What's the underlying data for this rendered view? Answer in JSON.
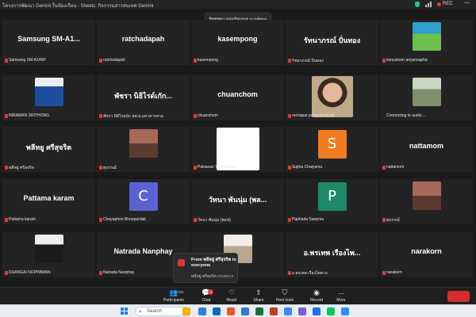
{
  "window": {
    "title": "โครงการพัฒนา Gemini ในห้องเรียน - Sheets: กิจกรรมสารสนเทศ Gemini",
    "status_rec": "REC",
    "colors": {
      "shield": "#2ec27e",
      "rec": "#e33333"
    }
  },
  "talking_banner": "รัชชทพา ผลจรัลมณย is talking...",
  "tiles": [
    {
      "big": "Samsung  SM-A1...",
      "label": "Samsung SM-A146P",
      "muted": true
    },
    {
      "big": "ratchadapah",
      "label": "ratchadapah",
      "muted": true
    },
    {
      "big": "kasempong",
      "label": "kasempong",
      "muted": true
    },
    {
      "big": "รัทนาภรณ์ ปั่นทอง",
      "label": "รัชนาภรณ์ ปั่นทอง",
      "muted": true
    },
    {
      "label": "kanyakorn anyarisapha",
      "muted": true,
      "photo": "cartoon"
    },
    {
      "label": "NIRAWAN SRITHONG",
      "muted": true,
      "photo": "woman-blue"
    },
    {
      "big": "พัชรา นิธิไรด์เกัก...",
      "label": "พัชรา นิธิไรดนัก สพ.ป.มหาสารคาม",
      "muted": true
    },
    {
      "big": "chuanchom",
      "label": "chuanchom",
      "muted": true
    },
    {
      "label": "rachapat pchayamahoot",
      "muted": true,
      "photo": "woman-glasses"
    },
    {
      "label": "Connecting to audio ...",
      "muted": false,
      "photo": "man-outdoor"
    },
    {
      "big": "พลีหยู ศรีสุจริต",
      "label": "พลีหยู่ ศรีสุจริต",
      "muted": true
    },
    {
      "label": "ศุภกรณ์",
      "muted": true,
      "photo": "person-indoor"
    },
    {
      "label": "Pakawan Thaveechai",
      "muted": true,
      "photo": "white"
    },
    {
      "avatar": "S",
      "avatar_color": "#f07d1f",
      "label": "Sujitra Chaiyama",
      "muted": true
    },
    {
      "big": "nattamom",
      "label": "nattamom",
      "muted": true
    },
    {
      "big": "Pattama karam",
      "label": "Pattama karam",
      "muted": true
    },
    {
      "avatar": "C",
      "avatar_color": "#5b63d3",
      "label": "Chayaphon Bhunpardab",
      "muted": true
    },
    {
      "big": "วัทนา พันนุ่ม (พล...",
      "label": "วัทนา พันนุ่ม (พลช)",
      "muted": true
    },
    {
      "avatar": "P",
      "avatar_color": "#1e8a69",
      "label": "Paphada Saepma",
      "muted": true
    },
    {
      "label": "ศุภกรณ์",
      "muted": true,
      "photo": "person-indoor"
    },
    {
      "label": "DUANGAI NOPPAWAN",
      "muted": true,
      "photo": "woman-dark"
    },
    {
      "big": "Natrada Nanphay",
      "label": "Natrada Nanphay",
      "muted": true
    },
    {
      "label": "",
      "muted": false,
      "photo": "man-partial"
    },
    {
      "big": "อ.พรเทพ เรืองไพ...",
      "label": "อ.พรเทพ เรืองไพศาล",
      "muted": true
    },
    {
      "big": "narakorn",
      "label": "narakorn",
      "muted": true
    }
  ],
  "chat_popup": {
    "from": "From พลีหยู่ ศรีสุจริต to everyone",
    "message": "พลีหยู่ ศรีสุจริต กระทรวง"
  },
  "toolbar": {
    "participants_label": "Participants",
    "participants_count": "285",
    "chat_label": "Chat",
    "chat_badge": "9",
    "react_label": "React",
    "share_label": "Share",
    "host_tools_label": "Host tools",
    "record_label": "Record",
    "more_label": "More"
  },
  "taskbar": {
    "search_placeholder": "Search"
  }
}
